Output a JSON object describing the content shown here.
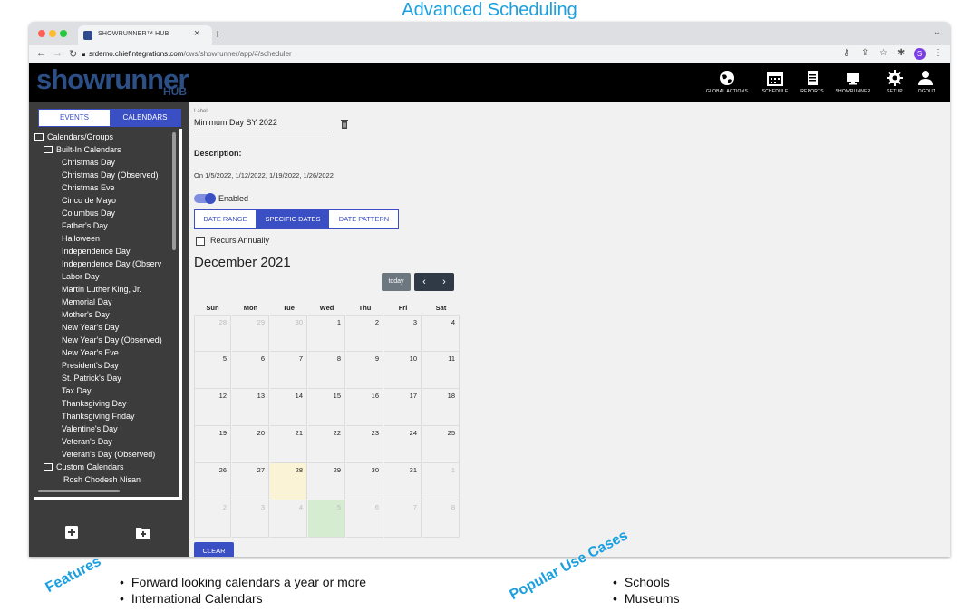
{
  "slide": {
    "title": "Advanced Scheduling",
    "features_tag": "Features",
    "usecases_tag": "Popular Use Cases",
    "features": [
      "Forward looking calendars a year or more",
      "International Calendars"
    ],
    "usecases": [
      "Schools",
      "Museums"
    ]
  },
  "browser": {
    "tab_title": "SHOWRUNNER™ HUB",
    "tab_close": "×",
    "new_tab": "+",
    "url_host": "srdemo.chiefintegrations.com",
    "url_path": "/cws/showrunner/app/#/scheduler",
    "profile_initial": "S"
  },
  "app": {
    "logo": "showrunner",
    "logo_sub": "HUB",
    "nav": [
      {
        "label": "GLOBAL ACTIONS",
        "icon": "globe-icon"
      },
      {
        "label": "SCHEDULE",
        "icon": "calendar-icon"
      },
      {
        "label": "REPORTS",
        "icon": "report-icon"
      },
      {
        "label": "SHOWRUNNER",
        "icon": "monitor-icon"
      },
      {
        "label": "SETUP",
        "icon": "gear-icon"
      },
      {
        "label": "LOGOUT",
        "icon": "user-icon"
      }
    ]
  },
  "sidebar": {
    "tab_events": "EVENTS",
    "tab_calendars": "CALENDARS",
    "tree": [
      {
        "label": "Calendars/Groups",
        "level": 0,
        "folder": true
      },
      {
        "label": "Built-In Calendars",
        "level": 1,
        "folder": true
      },
      {
        "label": "Christmas Day",
        "level": 2
      },
      {
        "label": "Christmas Day (Observed)",
        "level": 2
      },
      {
        "label": "Christmas Eve",
        "level": 2
      },
      {
        "label": "Cinco de Mayo",
        "level": 2
      },
      {
        "label": "Columbus Day",
        "level": 2
      },
      {
        "label": "Father's Day",
        "level": 2
      },
      {
        "label": "Halloween",
        "level": 2
      },
      {
        "label": "Independence Day",
        "level": 2
      },
      {
        "label": "Independence Day (Observ",
        "level": 2
      },
      {
        "label": "Labor Day",
        "level": 2
      },
      {
        "label": "Martin Luther King, Jr.",
        "level": 2
      },
      {
        "label": "Memorial Day",
        "level": 2
      },
      {
        "label": "Mother's Day",
        "level": 2
      },
      {
        "label": "New Year's Day",
        "level": 2
      },
      {
        "label": "New Year's Day (Observed)",
        "level": 2
      },
      {
        "label": "New Year's Eve",
        "level": 2
      },
      {
        "label": "President's Day",
        "level": 2
      },
      {
        "label": "St. Patrick's Day",
        "level": 2
      },
      {
        "label": "Tax Day",
        "level": 2
      },
      {
        "label": "Thanksgiving Day",
        "level": 2
      },
      {
        "label": "Thanksgiving Friday",
        "level": 2
      },
      {
        "label": "Valentine's Day",
        "level": 2
      },
      {
        "label": "Veteran's Day",
        "level": 2
      },
      {
        "label": "Veteran's Day (Observed)",
        "level": 2
      },
      {
        "label": "Custom Calendars",
        "level": 1,
        "folder": true
      },
      {
        "label": "Rosh Chodesh Nisan",
        "level": 3
      }
    ]
  },
  "editor": {
    "label_caption": "Label",
    "label_value": "Minimum Day SY 2022",
    "description_heading": "Description:",
    "description_text": "On 1/5/2022, 1/12/2022, 1/19/2022, 1/26/2022",
    "enabled_label": "Enabled",
    "mode_date_range": "DATE RANGE",
    "mode_specific": "SPECIFIC DATES",
    "mode_pattern": "DATE PATTERN",
    "recurs_label": "Recurs Annually",
    "clear_label": "CLEAR"
  },
  "calendar": {
    "title": "December 2021",
    "today_label": "today",
    "prev": "‹",
    "next": "›",
    "weekdays": [
      "Sun",
      "Mon",
      "Tue",
      "Wed",
      "Thu",
      "Fri",
      "Sat"
    ],
    "weeks": [
      [
        "28",
        "29",
        "30",
        "1",
        "2",
        "3",
        "4"
      ],
      [
        "5",
        "6",
        "7",
        "8",
        "9",
        "10",
        "11"
      ],
      [
        "12",
        "13",
        "14",
        "15",
        "16",
        "17",
        "18"
      ],
      [
        "19",
        "20",
        "21",
        "22",
        "23",
        "24",
        "25"
      ],
      [
        "26",
        "27",
        "28",
        "29",
        "30",
        "31",
        "1"
      ],
      [
        "2",
        "3",
        "4",
        "5",
        "6",
        "7",
        "8"
      ]
    ],
    "other_month": [
      [
        0,
        0
      ],
      [
        0,
        1
      ],
      [
        0,
        2
      ],
      [
        4,
        6
      ],
      [
        5,
        0
      ],
      [
        5,
        1
      ],
      [
        5,
        2
      ],
      [
        5,
        3
      ],
      [
        5,
        4
      ],
      [
        5,
        5
      ],
      [
        5,
        6
      ]
    ],
    "today": [
      4,
      2
    ],
    "selected": [
      5,
      3
    ]
  },
  "colors": {
    "accent": "#3b4fc4",
    "title_blue": "#1a9fe0",
    "logo_blue": "#2c4f86"
  }
}
